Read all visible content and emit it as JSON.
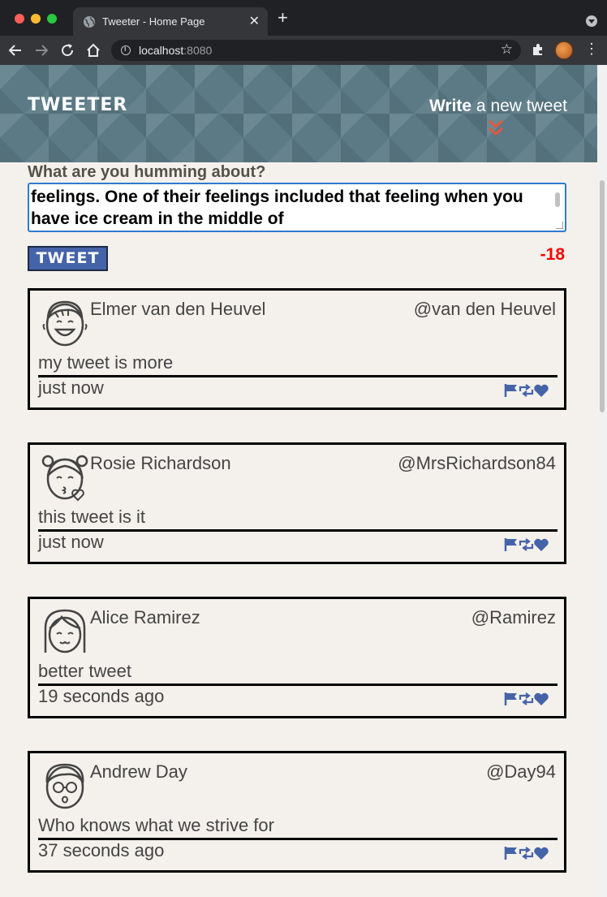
{
  "browser": {
    "tab_title": "Tweeter - Home Page",
    "tab_close": "✕",
    "new_tab": "+",
    "url_host": "localhost",
    "url_port": ":8080"
  },
  "header": {
    "logo": "TWEETER",
    "write_bold": "Write",
    "write_rest": " a new tweet"
  },
  "compose": {
    "label": "What are you humming about?",
    "text": "feelings. One of their feelings included that feeling when you have ice cream in the middle of",
    "button": "TWEET",
    "counter": "-18"
  },
  "colors": {
    "header_bg": "#5b7a86",
    "accent": "#e2583c",
    "button_bg": "#4563a8",
    "action_icons": "#4563a8",
    "counter_negative": "#ff0000"
  },
  "tweets": [
    {
      "name": "Elmer van den Heuvel",
      "handle": "@van den Heuvel",
      "text": "my tweet is more",
      "time": "just now",
      "avatar": "smiling-man-icon"
    },
    {
      "name": "Rosie Richardson",
      "handle": "@MrsRichardson84",
      "text": "this tweet is it",
      "time": "just now",
      "avatar": "kissing-girl-icon"
    },
    {
      "name": "Alice Ramirez",
      "handle": "@Ramirez",
      "text": "better tweet",
      "time": "19 seconds ago",
      "avatar": "happy-girl-icon"
    },
    {
      "name": "Andrew Day",
      "handle": "@Day94",
      "text": "Who knows what we strive for",
      "time": "37 seconds ago",
      "avatar": "man-with-glasses-icon"
    }
  ],
  "icons": [
    "flag-icon",
    "retweet-icon",
    "heart-icon"
  ]
}
